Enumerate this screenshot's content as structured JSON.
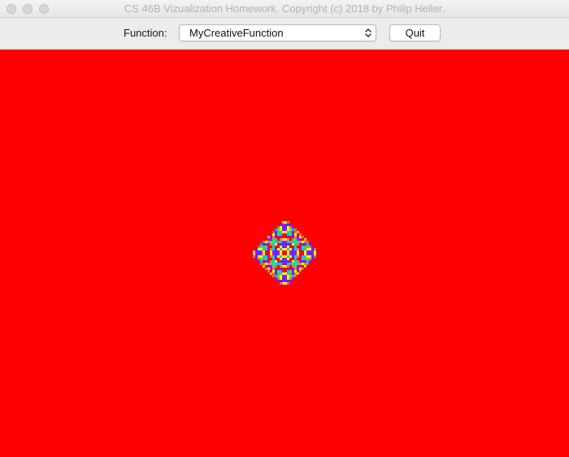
{
  "window": {
    "title": "CS 46B Vizualization Homework. Copyright (c) 2018 by Philip Heller."
  },
  "toolbar": {
    "function_label": "Function:",
    "function_select": {
      "selected": "MyCreativeFunction"
    },
    "quit_label": "Quit"
  },
  "canvas": {
    "background_color": "#ff0000",
    "pattern_colors": [
      "#ff0000",
      "#ff8000",
      "#ffff00",
      "#00ff66",
      "#00c8ff",
      "#3a3aff",
      "#b000ff"
    ]
  }
}
